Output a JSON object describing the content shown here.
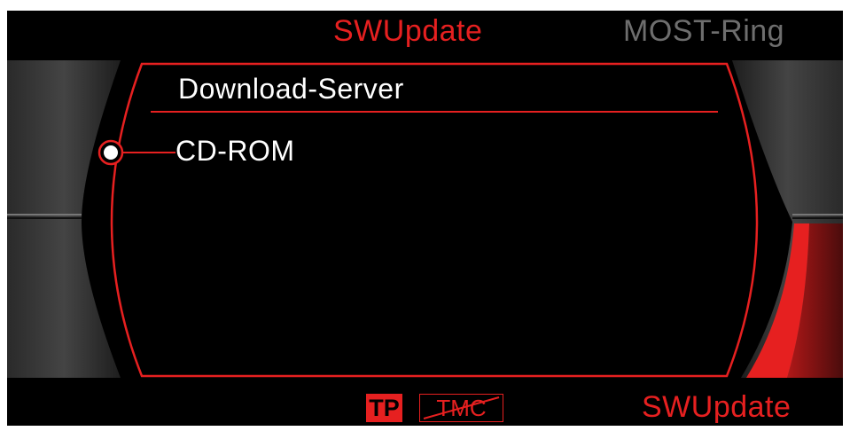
{
  "header": {
    "active_tab": "SWUpdate",
    "other_tab": "MOST-Ring"
  },
  "menu": {
    "title": "Download-Server",
    "items": [
      {
        "label": "CD-ROM",
        "selected": true
      }
    ]
  },
  "footer": {
    "softkey_right": "SWUpdate",
    "tp_badge": "TP",
    "tmc_badge": "TMC"
  },
  "colors": {
    "accent": "#e62020",
    "inactive": "#6e6e6e",
    "text": "#ffffff",
    "background": "#000000"
  },
  "icons": {
    "selection": "radio-dot-icon",
    "tmc_disabled": "strikethrough-icon"
  }
}
